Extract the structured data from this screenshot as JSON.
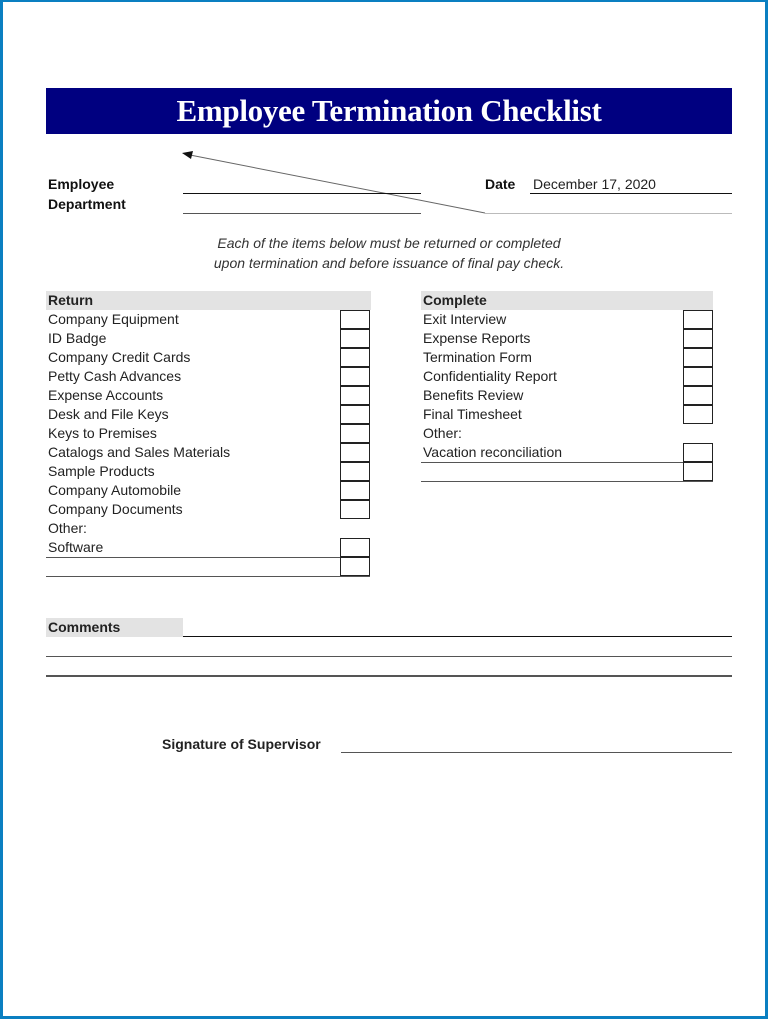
{
  "header": {
    "title": "Employee Termination Checklist"
  },
  "fields": {
    "employee_label": "Employee",
    "employee_value": "",
    "department_label": "Department",
    "department_value": "",
    "date_label": "Date",
    "date_value": "December 17, 2020"
  },
  "instructions": {
    "line1": "Each of the items below must be returned or completed",
    "line2": "upon termination and before issuance of final pay check."
  },
  "return_section": {
    "header": "Return",
    "items": [
      {
        "label": "Company Equipment",
        "checked": false
      },
      {
        "label": "ID Badge",
        "checked": false
      },
      {
        "label": "Company Credit Cards",
        "checked": false
      },
      {
        "label": "Petty Cash Advances",
        "checked": false
      },
      {
        "label": "Expense Accounts",
        "checked": false
      },
      {
        "label": "Desk and File Keys",
        "checked": false
      },
      {
        "label": "Keys to Premises",
        "checked": false
      },
      {
        "label": "Catalogs and Sales Materials",
        "checked": false
      },
      {
        "label": "Sample Products",
        "checked": false
      },
      {
        "label": "Company Automobile",
        "checked": false
      },
      {
        "label": "Company Documents",
        "checked": false
      }
    ],
    "other_label": "Other:",
    "other_items": [
      {
        "label": "Software",
        "checked": false
      },
      {
        "label": "",
        "checked": false
      }
    ]
  },
  "complete_section": {
    "header": "Complete",
    "items": [
      {
        "label": "Exit Interview",
        "checked": false
      },
      {
        "label": "Expense Reports",
        "checked": false
      },
      {
        "label": "Termination Form",
        "checked": false
      },
      {
        "label": "Confidentiality Report",
        "checked": false
      },
      {
        "label": "Benefits Review",
        "checked": false
      },
      {
        "label": "Final Timesheet",
        "checked": false
      }
    ],
    "other_label": "Other:",
    "other_items": [
      {
        "label": "Vacation reconciliation",
        "checked": false
      },
      {
        "label": "",
        "checked": false
      }
    ]
  },
  "comments": {
    "label": "Comments",
    "value": ""
  },
  "signature": {
    "label": "Signature of Supervisor",
    "value": ""
  },
  "colors": {
    "frame": "#0a7fc1",
    "title_bar": "#000080",
    "section_header_bg": "#e3e3e3"
  }
}
